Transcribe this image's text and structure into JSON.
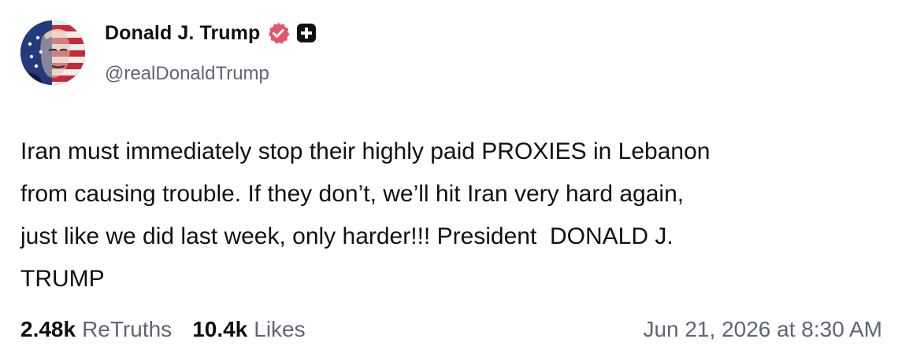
{
  "author": {
    "display_name": "Donald J. Trump",
    "handle": "@realDonaldTrump",
    "avatar_icon": "flag-portrait-avatar",
    "verified_icon": "verified-badge-icon",
    "verified_color": "#e8536b",
    "plus_icon": "plus-square-icon"
  },
  "post": {
    "text": "Iran must immediately stop their highly paid PROXIES in Lebanon\nfrom causing trouble. If they don’t, we’ll hit Iran very hard again,\njust like we did last week, only harder!!! President  DONALD J.\nTRUMP"
  },
  "stats": {
    "retruths_count": "2.48k",
    "retruths_label": "ReTruths",
    "likes_count": "10.4k",
    "likes_label": "Likes"
  },
  "timestamp": "Jun 21, 2026 at 8:30 AM"
}
